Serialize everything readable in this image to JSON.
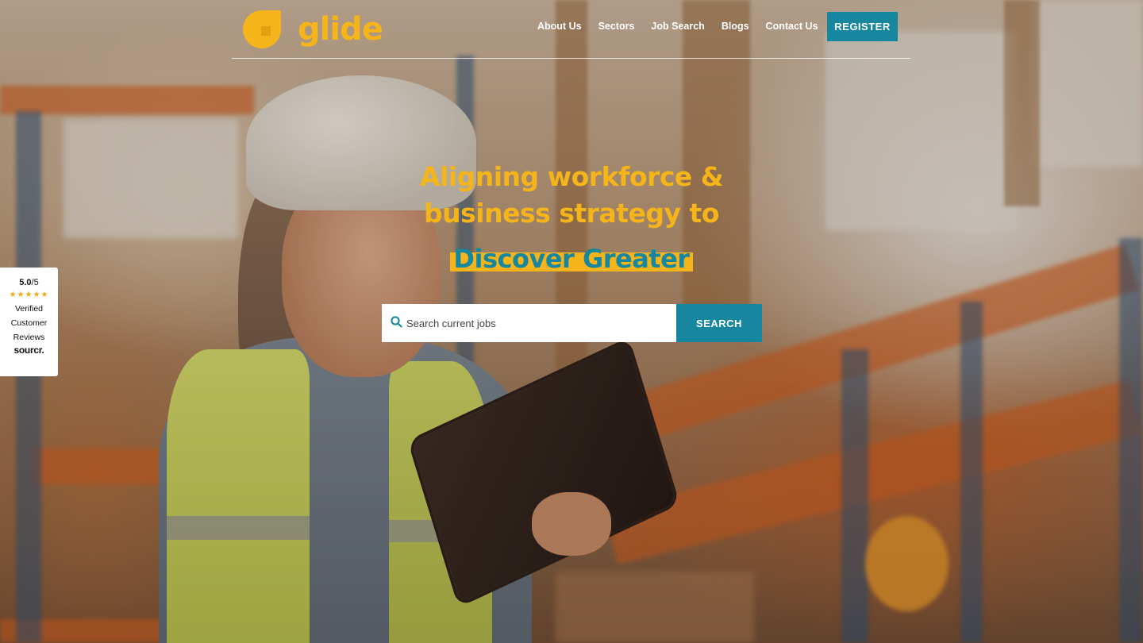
{
  "brand": {
    "name": "glide",
    "color": "#f4b41a",
    "accent_color": "#16879e"
  },
  "nav": {
    "items": [
      {
        "label": "About Us"
      },
      {
        "label": "Sectors"
      },
      {
        "label": "Job Search"
      },
      {
        "label": "Blogs"
      },
      {
        "label": "Contact Us"
      }
    ],
    "register_label": "REGISTER"
  },
  "hero": {
    "headline_line1": "Aligning workforce &",
    "headline_line2": "business strategy to",
    "highlight": "Discover Greater"
  },
  "search": {
    "placeholder": "Search current jobs",
    "value": "",
    "button_label": "SEARCH",
    "icon": "search-icon"
  },
  "review_badge": {
    "score": "5.0",
    "out_of": "/5",
    "stars": "★★★★★",
    "line1": "Verified",
    "line2": "Customer",
    "line3": "Reviews",
    "brand": "sourcr."
  }
}
